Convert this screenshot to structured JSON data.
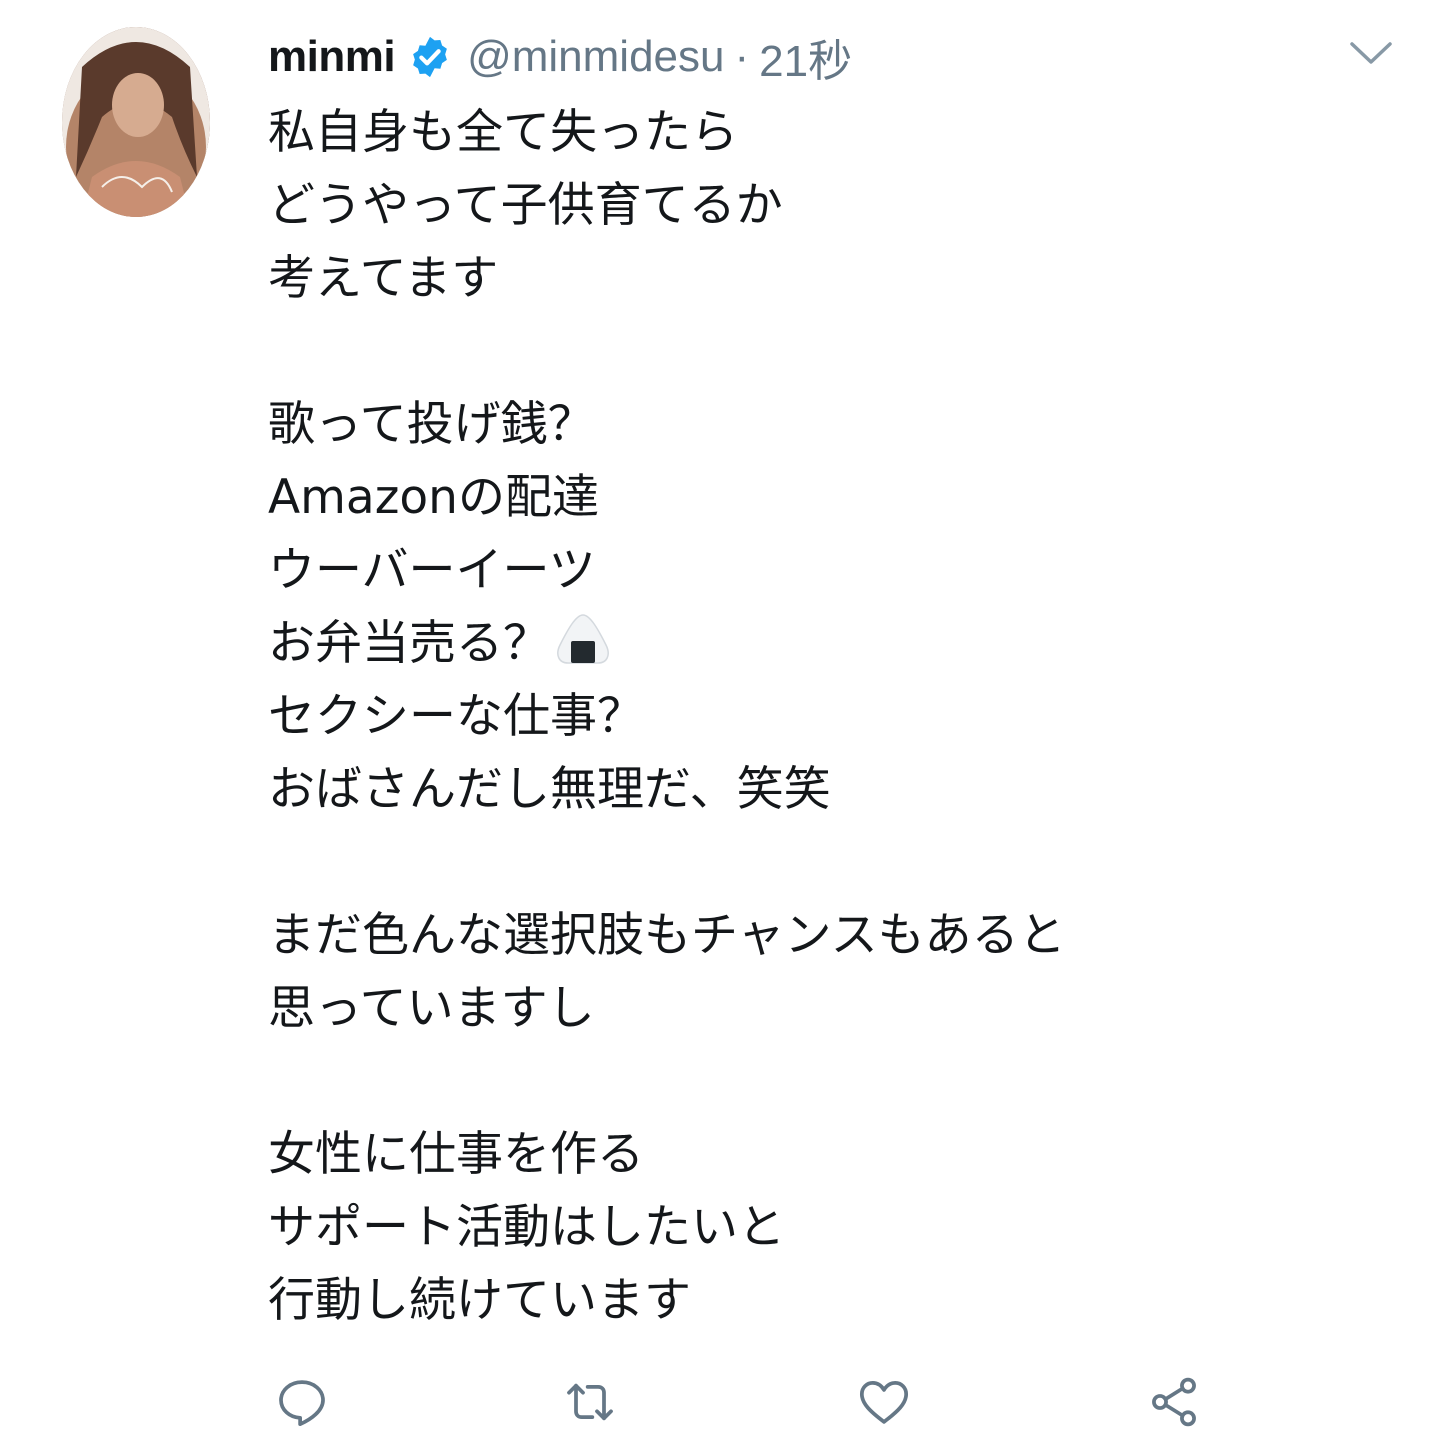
{
  "tweet": {
    "display_name": "minmi",
    "handle": "@minmidesu",
    "separator": "·",
    "time": "21秒",
    "verified_icon": "verified-badge-icon",
    "lines": [
      "私自身も全て失ったら",
      "どうやって子供育てるか",
      "考えてます",
      "",
      "歌って投げ銭？",
      "Amazonの配達",
      "ウーバーイーツ",
      "お弁当売る？",
      "セクシーな仕事？",
      "おばさんだし無理だ、笑笑",
      "",
      "まだ色んな選択肢もチャンスもあると",
      "思っていますし",
      "",
      "女性に仕事を作る",
      "サポート活動はしたいと",
      "行動し続けています"
    ]
  },
  "icons": {
    "avatar": "profile-photo",
    "caret": "chevron-down-icon",
    "onigiri": "rice-ball-emoji",
    "reply": "reply-icon",
    "retweet": "retweet-icon",
    "like": "heart-icon",
    "share": "share-icon"
  },
  "colors": {
    "text": "#14171a",
    "secondary": "#657786",
    "verified": "#1da1f2",
    "icon": "#657786"
  }
}
